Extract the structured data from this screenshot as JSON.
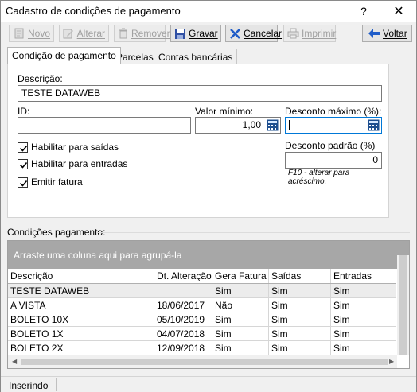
{
  "window": {
    "title": "Cadastro de condições de pagamento",
    "help_icon": "?",
    "close_icon": "✕"
  },
  "toolbar": {
    "novo": "Novo",
    "alterar": "Alterar",
    "remover": "Remover",
    "gravar": "Gravar",
    "cancelar": "Cancelar",
    "imprimir": "Imprimir",
    "voltar": "Voltar"
  },
  "tabs": [
    "Condição de pagamento",
    "Parcelas",
    "Contas bancárias"
  ],
  "form": {
    "descricao_label": "Descrição:",
    "descricao_value": "TESTE DATAWEB",
    "id_label": "ID:",
    "id_value": "",
    "valor_minimo_label": "Valor mínimo:",
    "valor_minimo_value": "1,00",
    "desconto_maximo_label": "Desconto máximo (%):",
    "desconto_maximo_value": "",
    "desconto_padrao_label": "Desconto padrão (%)",
    "desconto_padrao_value": "0",
    "hint": "F10 - alterar para acréscimo.",
    "checkboxes": [
      {
        "label": "Habilitar para saídas",
        "checked": true
      },
      {
        "label": "Habilitar para entradas",
        "checked": true
      },
      {
        "label": "Emitir fatura",
        "checked": true
      }
    ]
  },
  "grid": {
    "group_label": "Condições pagamento:",
    "group_by_text": "Arraste uma coluna aqui para agrupá-la",
    "columns": [
      "Descrição",
      "Dt. Alteração",
      "Gera Fatura",
      "Saídas",
      "Entradas"
    ],
    "rows": [
      [
        "TESTE DATAWEB",
        "",
        "Sim",
        "Sim",
        "Sim"
      ],
      [
        "A VISTA",
        "18/06/2017",
        "Não",
        "Sim",
        "Sim"
      ],
      [
        "BOLETO 10X",
        "05/10/2019",
        "Sim",
        "Sim",
        "Sim"
      ],
      [
        "BOLETO 1X",
        "04/07/2018",
        "Sim",
        "Sim",
        "Sim"
      ],
      [
        "BOLETO 2X",
        "12/09/2018",
        "Sim",
        "Sim",
        "Sim"
      ]
    ]
  },
  "status": {
    "mode": "Inserindo"
  },
  "colors": {
    "accent": "#0078d7",
    "groupby_bg": "#a7a7a7"
  }
}
